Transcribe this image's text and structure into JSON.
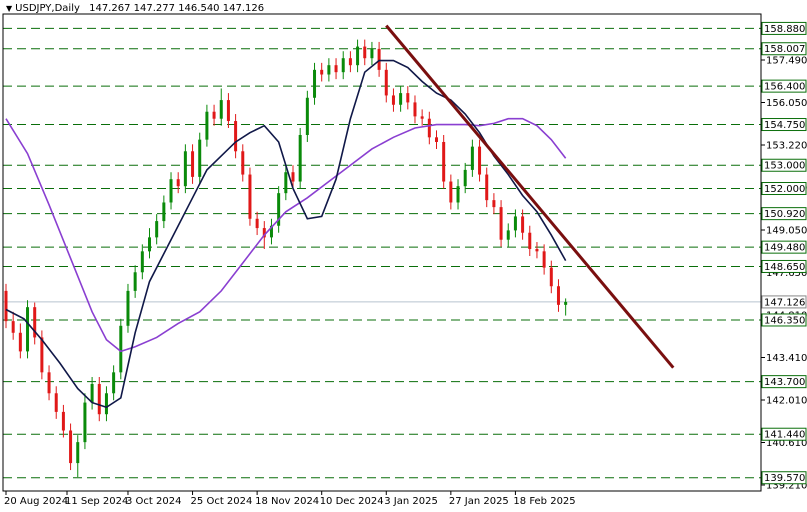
{
  "chart_data": {
    "type": "candlestick",
    "symbol": "USDJPY",
    "timeframe": "Daily",
    "ohlc_header": {
      "open": "147.267",
      "high": "147.277",
      "low": "146.540",
      "close": "147.126"
    },
    "ylim": [
      139.0,
      159.5
    ],
    "x_range": [
      0,
      160
    ],
    "y_tick_labels": [
      "157.490",
      "156.050",
      "153.220",
      "150.450",
      "149.050",
      "147.650",
      "144.810",
      "143.410",
      "142.010",
      "140.610",
      "139.210"
    ],
    "x_tick_labels": [
      {
        "label": "20 Aug 2024",
        "x": 0
      },
      {
        "label": "11 Sep 2024",
        "x": 17
      },
      {
        "label": "3 Oct 2024",
        "x": 34
      },
      {
        "label": "25 Oct 2024",
        "x": 52
      },
      {
        "label": "18 Nov 2024",
        "x": 70
      },
      {
        "label": "10 Dec 2024",
        "x": 88
      },
      {
        "label": "3 Jan 2025",
        "x": 106
      },
      {
        "label": "27 Jan 2025",
        "x": 124
      },
      {
        "label": "18 Feb 2025",
        "x": 142
      }
    ],
    "horizontal_levels": [
      {
        "label": "158.880",
        "value": 158.88
      },
      {
        "label": "158.007",
        "value": 158.007
      },
      {
        "label": "156.400",
        "value": 156.4
      },
      {
        "label": "154.750",
        "value": 154.75
      },
      {
        "label": "153.000",
        "value": 153.0
      },
      {
        "label": "152.000",
        "value": 152.0
      },
      {
        "label": "150.920",
        "value": 150.92
      },
      {
        "label": "149.480",
        "value": 149.48
      },
      {
        "label": "148.650",
        "value": 148.65
      },
      {
        "label": "146.350",
        "value": 146.35
      },
      {
        "label": "143.700",
        "value": 143.7
      },
      {
        "label": "141.440",
        "value": 141.44
      },
      {
        "label": "139.570",
        "value": 139.57
      }
    ],
    "current_price": {
      "label": "147.126",
      "value": 147.126
    },
    "trendline": {
      "x1": 106,
      "y1": 159.0,
      "x2": 186,
      "y2": 144.3
    },
    "fast_ma": {
      "x": [
        0,
        5,
        10,
        15,
        20,
        24,
        28,
        32,
        36,
        40,
        46,
        52,
        56,
        60,
        64,
        68,
        72,
        76,
        80,
        84,
        88,
        92,
        96,
        100,
        104,
        108,
        112,
        116,
        120,
        124,
        128,
        132,
        136,
        140,
        144,
        148,
        152,
        156
      ],
      "y": [
        146.8,
        146.4,
        145.5,
        144.5,
        143.4,
        142.8,
        142.6,
        143.0,
        145.8,
        148.0,
        149.8,
        151.6,
        152.8,
        153.4,
        154.0,
        154.4,
        154.7,
        154.0,
        152.0,
        150.7,
        150.8,
        152.4,
        155.0,
        157.0,
        157.5,
        157.5,
        157.2,
        156.6,
        156.1,
        155.8,
        155.2,
        154.4,
        153.4,
        152.6,
        151.7,
        151.0,
        150.0,
        148.9
      ]
    },
    "slow_ma": {
      "x": [
        0,
        6,
        12,
        18,
        24,
        28,
        32,
        36,
        42,
        48,
        54,
        60,
        66,
        72,
        78,
        84,
        90,
        96,
        102,
        108,
        114,
        120,
        124,
        128,
        132,
        136,
        140,
        144,
        148,
        152,
        156
      ],
      "y": [
        155.0,
        153.5,
        151.3,
        149.0,
        146.7,
        145.5,
        145.0,
        145.2,
        145.6,
        146.2,
        146.7,
        147.6,
        148.8,
        150.0,
        151.0,
        151.6,
        152.3,
        153.0,
        153.7,
        154.2,
        154.6,
        154.75,
        154.75,
        154.75,
        154.7,
        154.8,
        155.0,
        155.0,
        154.7,
        154.1,
        153.3
      ]
    },
    "candles": {
      "x": [
        0,
        2,
        4,
        6,
        8,
        10,
        12,
        14,
        16,
        18,
        20,
        22,
        24,
        26,
        28,
        30,
        32,
        34,
        36,
        38,
        40,
        42,
        44,
        46,
        48,
        50,
        52,
        54,
        56,
        58,
        60,
        62,
        64,
        66,
        68,
        70,
        72,
        74,
        76,
        78,
        80,
        82,
        84,
        86,
        88,
        90,
        92,
        94,
        96,
        98,
        100,
        102,
        104,
        106,
        108,
        110,
        112,
        114,
        116,
        118,
        120,
        122,
        124,
        126,
        128,
        130,
        132,
        134,
        136,
        138,
        140,
        142,
        144,
        146,
        148,
        150,
        152,
        154,
        156
      ],
      "open": [
        147.6,
        146.3,
        145.8,
        145.0,
        146.9,
        145.6,
        144.1,
        143.2,
        142.4,
        141.6,
        140.2,
        141.1,
        142.8,
        143.6,
        142.3,
        143.2,
        144.1,
        146.1,
        147.6,
        148.4,
        149.3,
        149.9,
        150.6,
        151.4,
        152.4,
        152.1,
        153.6,
        152.5,
        154.1,
        155.3,
        155.0,
        155.8,
        154.9,
        153.6,
        152.6,
        150.7,
        150.3,
        149.9,
        150.4,
        151.8,
        152.7,
        152.3,
        154.3,
        155.9,
        157.1,
        156.9,
        157.3,
        157.0,
        157.6,
        157.3,
        158.1,
        157.6,
        158.0,
        157.1,
        156.0,
        155.6,
        156.1,
        155.7,
        155.1,
        155.0,
        154.2,
        154.0,
        152.3,
        151.4,
        152.1,
        152.8,
        153.8,
        152.6,
        151.5,
        151.2,
        149.8,
        150.2,
        150.8,
        150.1,
        149.4,
        149.3,
        148.6,
        147.8,
        147.0
      ],
      "close": [
        146.3,
        145.8,
        145.0,
        146.9,
        145.6,
        144.1,
        143.2,
        142.4,
        141.6,
        140.2,
        141.1,
        142.8,
        143.6,
        142.3,
        143.2,
        144.1,
        146.1,
        147.6,
        148.4,
        149.3,
        149.9,
        150.6,
        151.4,
        152.4,
        152.1,
        153.6,
        152.5,
        154.1,
        155.3,
        155.0,
        155.8,
        154.9,
        153.6,
        152.6,
        150.7,
        150.3,
        149.9,
        150.4,
        151.8,
        152.7,
        152.3,
        154.3,
        155.9,
        157.1,
        156.9,
        157.3,
        157.0,
        157.6,
        157.3,
        158.1,
        157.6,
        158.0,
        157.1,
        156.0,
        155.6,
        156.1,
        155.7,
        155.1,
        155.0,
        154.2,
        154.0,
        152.3,
        151.4,
        152.1,
        152.8,
        153.8,
        152.6,
        151.5,
        151.2,
        149.8,
        150.2,
        150.8,
        150.1,
        149.4,
        149.3,
        148.6,
        147.8,
        147.0,
        147.126
      ],
      "high": [
        147.9,
        146.7,
        146.2,
        147.2,
        147.1,
        145.9,
        144.4,
        143.5,
        142.7,
        141.9,
        141.4,
        143.2,
        143.9,
        143.9,
        143.5,
        144.4,
        146.4,
        147.9,
        148.7,
        149.6,
        150.3,
        150.9,
        151.7,
        152.7,
        152.7,
        153.9,
        153.9,
        154.4,
        155.6,
        155.6,
        156.3,
        156.1,
        155.2,
        153.9,
        152.9,
        151.0,
        150.6,
        150.7,
        152.1,
        153.0,
        153.0,
        154.6,
        156.2,
        157.4,
        157.4,
        157.6,
        157.6,
        157.9,
        157.9,
        158.4,
        158.4,
        158.3,
        158.3,
        157.4,
        156.3,
        156.4,
        156.4,
        156.0,
        155.4,
        155.3,
        154.5,
        154.3,
        152.6,
        152.4,
        153.1,
        154.1,
        154.1,
        152.9,
        151.8,
        151.5,
        150.5,
        151.1,
        151.1,
        150.4,
        149.7,
        149.6,
        148.9,
        148.1,
        147.277
      ],
      "low": [
        146.0,
        145.5,
        144.7,
        144.7,
        145.3,
        143.8,
        142.9,
        142.1,
        141.3,
        139.9,
        139.6,
        140.8,
        142.5,
        142.0,
        142.0,
        142.9,
        143.8,
        145.8,
        147.3,
        148.1,
        149.0,
        149.6,
        150.3,
        151.1,
        151.8,
        151.8,
        152.2,
        152.2,
        153.8,
        154.7,
        154.7,
        154.6,
        153.3,
        152.3,
        150.4,
        150.0,
        149.4,
        149.6,
        150.1,
        151.5,
        152.0,
        152.0,
        154.0,
        155.6,
        156.6,
        156.6,
        156.7,
        156.7,
        157.0,
        157.0,
        157.3,
        157.3,
        156.8,
        155.7,
        155.3,
        155.3,
        155.4,
        154.8,
        154.7,
        153.9,
        153.7,
        152.0,
        151.1,
        151.1,
        151.8,
        152.5,
        152.3,
        151.2,
        150.9,
        149.5,
        149.5,
        149.9,
        149.8,
        149.1,
        149.0,
        148.3,
        147.5,
        146.7,
        146.54
      ]
    }
  }
}
